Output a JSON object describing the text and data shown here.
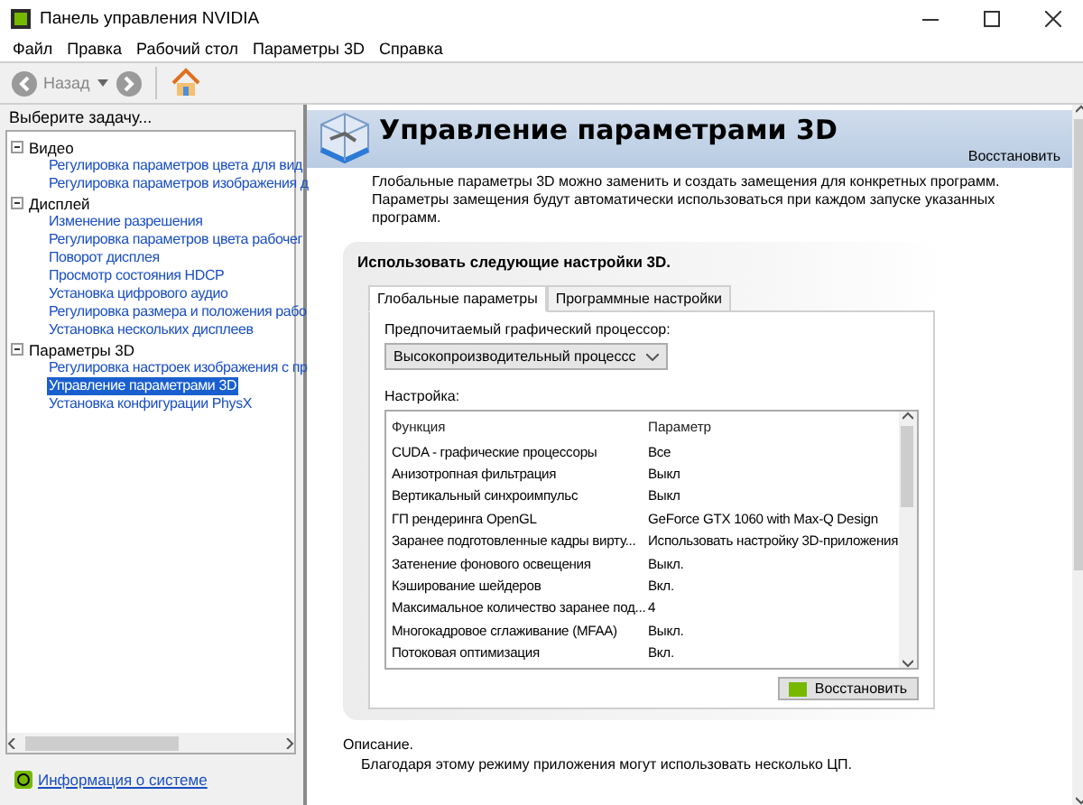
{
  "window": {
    "title": "Панель управления NVIDIA"
  },
  "menu": [
    "Файл",
    "Правка",
    "Рабочий стол",
    "Параметры 3D",
    "Справка"
  ],
  "toolbar": {
    "back_label": "Назад"
  },
  "sidebar": {
    "prompt": "Выберите задачу...",
    "tree": [
      {
        "label": "Видео",
        "expanded": true,
        "children": [
          {
            "label": "Регулировка параметров цвета для вид",
            "selected": false
          },
          {
            "label": "Регулировка параметров изображения д",
            "selected": false
          }
        ]
      },
      {
        "label": "Дисплей",
        "expanded": true,
        "children": [
          {
            "label": "Изменение разрешения",
            "selected": false
          },
          {
            "label": "Регулировка параметров цвета рабочег",
            "selected": false
          },
          {
            "label": "Поворот дисплея",
            "selected": false
          },
          {
            "label": "Просмотр состояния HDCP",
            "selected": false
          },
          {
            "label": "Установка цифрового аудио",
            "selected": false
          },
          {
            "label": "Регулировка размера и положения рабо",
            "selected": false
          },
          {
            "label": "Установка нескольких дисплеев",
            "selected": false
          }
        ]
      },
      {
        "label": "Параметры 3D",
        "expanded": true,
        "children": [
          {
            "label": "Регулировка настроек изображения с пр",
            "selected": false
          },
          {
            "label": "Управление параметрами 3D",
            "selected": true
          },
          {
            "label": "Установка конфигурации PhysX",
            "selected": false
          }
        ]
      }
    ],
    "system_info_link": "Информация о системе"
  },
  "page": {
    "title": "Управление параметрами 3D",
    "restore_link": "Восстановить",
    "description": "Глобальные параметры 3D можно заменить и создать замещения для конкретных программ. Параметры замещения будут автоматически использоваться при каждом запуске указанных программ.",
    "card": {
      "title": "Использовать следующие настройки 3D.",
      "tabs": [
        {
          "label": "Глобальные параметры",
          "selected": true
        },
        {
          "label": "Программные настройки",
          "selected": false
        }
      ],
      "gpu_label": "Предпочитаемый графический процессор:",
      "gpu_value": "Высокопроизводительный процессс",
      "settings_label": "Настройка:",
      "columns": [
        "Функция",
        "Параметр"
      ],
      "rows": [
        [
          "CUDA - графические процессоры",
          "Все"
        ],
        [
          "Анизотропная фильтрация",
          "Выкл"
        ],
        [
          "Вертикальный синхроимпульс",
          "Выкл"
        ],
        [
          "ГП рендеринга OpenGL",
          "GeForce GTX 1060 with Max-Q Design"
        ],
        [
          "Заранее подготовленные кадры вирту...",
          "Использовать настройку 3D-приложения"
        ],
        [
          "Затенение фонового освещения",
          "Выкл."
        ],
        [
          "Кэширование шейдеров",
          "Вкл."
        ],
        [
          "Максимальное количество заранее под...",
          "4"
        ],
        [
          "Многокадровое сглаживание (MFAA)",
          "Выкл."
        ],
        [
          "Потоковая оптимизация",
          "Вкл."
        ]
      ],
      "restore_button": "Восстановить"
    }
  },
  "footer": {
    "label": "Описание.",
    "text": "Благодаря этому режиму приложения могут использовать несколько ЦП."
  }
}
